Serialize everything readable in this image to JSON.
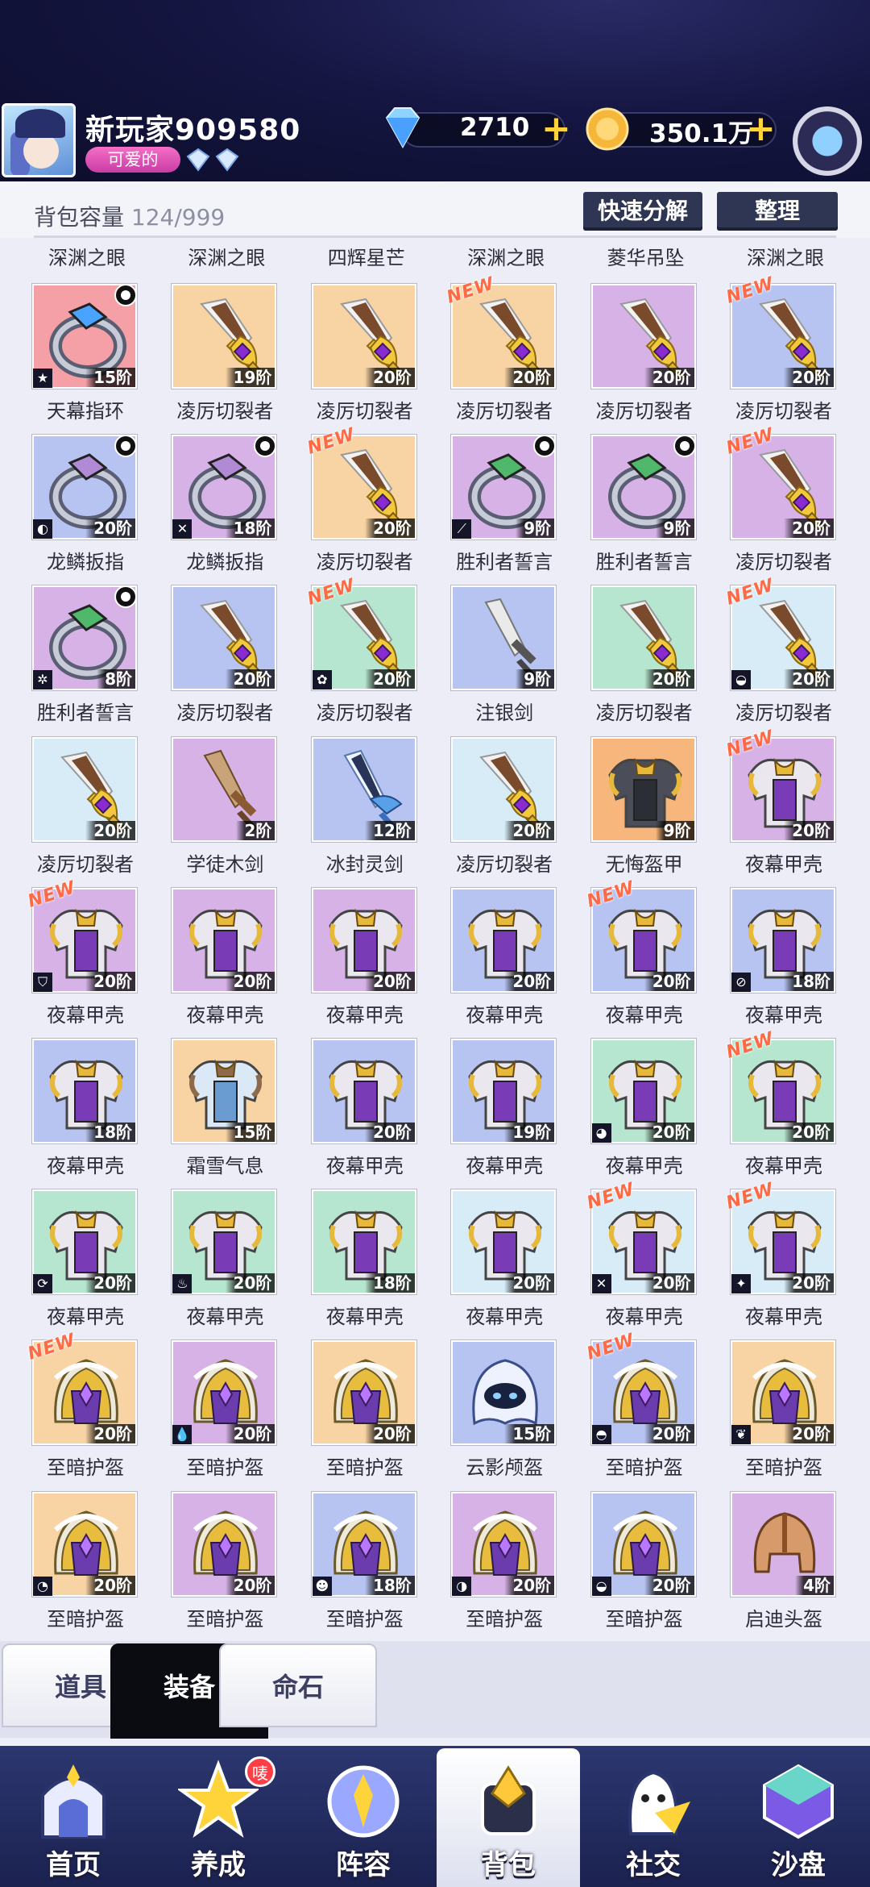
{
  "player": {
    "name": "新玩家909580",
    "tag": "可爱的"
  },
  "resources": {
    "gems": "2710",
    "coins": "350.1万",
    "gem_icon": "diamond-icon",
    "coin_icon": "coin-icon"
  },
  "bag": {
    "capacity_label": "背包容量",
    "capacity_value": "124/999",
    "decompose_label": "快速分解",
    "sort_label": "整理"
  },
  "partial_row_names": [
    "深渊之眼",
    "深渊之眼",
    "四辉星芒",
    "深渊之眼",
    "菱华吊坠",
    "深渊之眼"
  ],
  "items": [
    {
      "name": "天幕指环",
      "level": "15阶",
      "type": "ring",
      "gem": "#4aa3ff",
      "bg": "#f5a0a6",
      "new": false,
      "socket": true,
      "slot": "★"
    },
    {
      "name": "凌厉切裂者",
      "level": "19阶",
      "type": "sword",
      "bg": "#f8d3a4",
      "new": false,
      "socket": false,
      "slot": ""
    },
    {
      "name": "凌厉切裂者",
      "level": "20阶",
      "type": "sword",
      "bg": "#f8d3a4",
      "new": false,
      "socket": false,
      "slot": ""
    },
    {
      "name": "凌厉切裂者",
      "level": "20阶",
      "type": "sword",
      "bg": "#f8d3a4",
      "new": true,
      "socket": false,
      "slot": ""
    },
    {
      "name": "凌厉切裂者",
      "level": "20阶",
      "type": "sword",
      "bg": "#d6b2e6",
      "new": false,
      "socket": false,
      "slot": ""
    },
    {
      "name": "凌厉切裂者",
      "level": "20阶",
      "type": "sword",
      "bg": "#b7c3f1",
      "new": true,
      "socket": false,
      "slot": ""
    },
    {
      "name": "龙鳞扳指",
      "level": "20阶",
      "type": "ring",
      "gem": "#b18ad6",
      "bg": "#b7c3f1",
      "new": false,
      "socket": true,
      "slot": "◐"
    },
    {
      "name": "龙鳞扳指",
      "level": "18阶",
      "type": "ring",
      "gem": "#b18ad6",
      "bg": "#d6b2e6",
      "new": false,
      "socket": true,
      "slot": "✕"
    },
    {
      "name": "凌厉切裂者",
      "level": "20阶",
      "type": "sword",
      "bg": "#f8d3a4",
      "new": true,
      "socket": false,
      "slot": ""
    },
    {
      "name": "胜利者誓言",
      "level": "9阶",
      "type": "ring",
      "gem": "#4fb86a",
      "bg": "#d6b2e6",
      "new": false,
      "socket": true,
      "slot": "⟋"
    },
    {
      "name": "胜利者誓言",
      "level": "9阶",
      "type": "ring",
      "gem": "#4fb86a",
      "bg": "#d6b2e6",
      "new": false,
      "socket": true,
      "slot": ""
    },
    {
      "name": "凌厉切裂者",
      "level": "20阶",
      "type": "sword",
      "bg": "#d6b2e6",
      "new": true,
      "socket": false,
      "slot": ""
    },
    {
      "name": "胜利者誓言",
      "level": "8阶",
      "type": "ring",
      "gem": "#4fb86a",
      "bg": "#d6b2e6",
      "new": false,
      "socket": true,
      "slot": "✲"
    },
    {
      "name": "凌厉切裂者",
      "level": "20阶",
      "type": "sword",
      "bg": "#b7c3f1",
      "new": false,
      "socket": false,
      "slot": ""
    },
    {
      "name": "凌厉切裂者",
      "level": "20阶",
      "type": "sword",
      "bg": "#b6e6cf",
      "new": true,
      "socket": false,
      "slot": "✿"
    },
    {
      "name": "注银剑",
      "level": "9阶",
      "type": "plainsword",
      "bg": "#b7c3f1",
      "new": false,
      "socket": false,
      "slot": ""
    },
    {
      "name": "凌厉切裂者",
      "level": "20阶",
      "type": "sword",
      "bg": "#b6e6cf",
      "new": false,
      "socket": false,
      "slot": ""
    },
    {
      "name": "凌厉切裂者",
      "level": "20阶",
      "type": "sword",
      "bg": "#d7ecf7",
      "new": true,
      "socket": false,
      "slot": "◒"
    },
    {
      "name": "凌厉切裂者",
      "level": "20阶",
      "type": "sword",
      "bg": "#d7ecf7",
      "new": false,
      "socket": false,
      "slot": ""
    },
    {
      "name": "学徒木剑",
      "level": "2阶",
      "type": "woodsword",
      "bg": "#d6b2e6",
      "new": false,
      "socket": false,
      "slot": ""
    },
    {
      "name": "冰封灵剑",
      "level": "12阶",
      "type": "icesword",
      "bg": "#b7c3f1",
      "new": false,
      "socket": false,
      "slot": ""
    },
    {
      "name": "凌厉切裂者",
      "level": "20阶",
      "type": "sword",
      "bg": "#d7ecf7",
      "new": false,
      "socket": false,
      "slot": ""
    },
    {
      "name": "无悔盔甲",
      "level": "9阶",
      "type": "darkarmor",
      "bg": "#f7b77c",
      "new": false,
      "socket": false,
      "slot": ""
    },
    {
      "name": "夜幕甲壳",
      "level": "20阶",
      "type": "armor",
      "bg": "#d6b2e6",
      "new": true,
      "socket": false,
      "slot": ""
    },
    {
      "name": "夜幕甲壳",
      "level": "20阶",
      "type": "armor",
      "bg": "#d6b2e6",
      "new": true,
      "socket": false,
      "slot": "⛉"
    },
    {
      "name": "夜幕甲壳",
      "level": "20阶",
      "type": "armor",
      "bg": "#d6b2e6",
      "new": false,
      "socket": false,
      "slot": ""
    },
    {
      "name": "夜幕甲壳",
      "level": "20阶",
      "type": "armor",
      "bg": "#d6b2e6",
      "new": false,
      "socket": false,
      "slot": ""
    },
    {
      "name": "夜幕甲壳",
      "level": "20阶",
      "type": "armor",
      "bg": "#b7c3f1",
      "new": false,
      "socket": false,
      "slot": ""
    },
    {
      "name": "夜幕甲壳",
      "level": "20阶",
      "type": "armor",
      "bg": "#b7c3f1",
      "new": true,
      "socket": false,
      "slot": ""
    },
    {
      "name": "夜幕甲壳",
      "level": "18阶",
      "type": "armor",
      "bg": "#b7c3f1",
      "new": false,
      "socket": false,
      "slot": "⊘"
    },
    {
      "name": "夜幕甲壳",
      "level": "18阶",
      "type": "armor",
      "bg": "#b7c3f1",
      "new": false,
      "socket": false,
      "slot": ""
    },
    {
      "name": "霜雪气息",
      "level": "15阶",
      "type": "frostarmor",
      "bg": "#f8d3a4",
      "new": false,
      "socket": false,
      "slot": ""
    },
    {
      "name": "夜幕甲壳",
      "level": "20阶",
      "type": "armor",
      "bg": "#b7c3f1",
      "new": false,
      "socket": false,
      "slot": ""
    },
    {
      "name": "夜幕甲壳",
      "level": "19阶",
      "type": "armor",
      "bg": "#b7c3f1",
      "new": false,
      "socket": false,
      "slot": ""
    },
    {
      "name": "夜幕甲壳",
      "level": "20阶",
      "type": "armor",
      "bg": "#b6e6cf",
      "new": false,
      "socket": false,
      "slot": "◕"
    },
    {
      "name": "夜幕甲壳",
      "level": "20阶",
      "type": "armor",
      "bg": "#b6e6cf",
      "new": true,
      "socket": false,
      "slot": ""
    },
    {
      "name": "夜幕甲壳",
      "level": "20阶",
      "type": "armor",
      "bg": "#b6e6cf",
      "new": false,
      "socket": false,
      "slot": "⟳"
    },
    {
      "name": "夜幕甲壳",
      "level": "20阶",
      "type": "armor",
      "bg": "#b6e6cf",
      "new": false,
      "socket": false,
      "slot": "♨"
    },
    {
      "name": "夜幕甲壳",
      "level": "18阶",
      "type": "armor",
      "bg": "#b6e6cf",
      "new": false,
      "socket": false,
      "slot": ""
    },
    {
      "name": "夜幕甲壳",
      "level": "20阶",
      "type": "armor",
      "bg": "#d7ecf7",
      "new": false,
      "socket": false,
      "slot": ""
    },
    {
      "name": "夜幕甲壳",
      "level": "20阶",
      "type": "armor",
      "bg": "#d7ecf7",
      "new": true,
      "socket": false,
      "slot": "✕"
    },
    {
      "name": "夜幕甲壳",
      "level": "20阶",
      "type": "armor",
      "bg": "#d7ecf7",
      "new": true,
      "socket": false,
      "slot": "✦"
    },
    {
      "name": "至暗护盔",
      "level": "20阶",
      "type": "helm",
      "bg": "#f8d3a4",
      "new": true,
      "socket": false,
      "slot": ""
    },
    {
      "name": "至暗护盔",
      "level": "20阶",
      "type": "helm",
      "bg": "#d6b2e6",
      "new": false,
      "socket": false,
      "slot": "💧"
    },
    {
      "name": "至暗护盔",
      "level": "20阶",
      "type": "helm",
      "bg": "#f8d3a4",
      "new": false,
      "socket": false,
      "slot": ""
    },
    {
      "name": "云影颅盔",
      "level": "15阶",
      "type": "ghosthelm",
      "bg": "#b7c3f1",
      "new": false,
      "socket": false,
      "slot": ""
    },
    {
      "name": "至暗护盔",
      "level": "20阶",
      "type": "helm",
      "bg": "#b7c3f1",
      "new": true,
      "socket": false,
      "slot": "◓"
    },
    {
      "name": "至暗护盔",
      "level": "20阶",
      "type": "helm",
      "bg": "#f8d3a4",
      "new": false,
      "socket": false,
      "slot": "❦"
    },
    {
      "name": "至暗护盔",
      "level": "20阶",
      "type": "helm",
      "bg": "#f8d3a4",
      "new": false,
      "socket": false,
      "slot": "◔"
    },
    {
      "name": "至暗护盔",
      "level": "20阶",
      "type": "helm",
      "bg": "#d6b2e6",
      "new": false,
      "socket": false,
      "slot": ""
    },
    {
      "name": "至暗护盔",
      "level": "18阶",
      "type": "helm",
      "bg": "#b7c3f1",
      "new": false,
      "socket": false,
      "slot": "☻"
    },
    {
      "name": "至暗护盔",
      "level": "20阶",
      "type": "helm",
      "bg": "#d6b2e6",
      "new": false,
      "socket": false,
      "slot": "◑"
    },
    {
      "name": "至暗护盔",
      "level": "20阶",
      "type": "helm",
      "bg": "#b7c3f1",
      "new": false,
      "socket": false,
      "slot": "◒"
    },
    {
      "name": "启迪头盔",
      "level": "4阶",
      "type": "leatherhelm",
      "bg": "#d6b2e6",
      "new": false,
      "socket": false,
      "slot": ""
    }
  ],
  "new_label": "NEW",
  "category_tabs": [
    {
      "label": "道具",
      "active": false
    },
    {
      "label": "装备",
      "active": true
    },
    {
      "label": "命石",
      "active": false
    }
  ],
  "nav": [
    {
      "label": "首页",
      "icon": "home-gate-icon",
      "active": false,
      "badge": ""
    },
    {
      "label": "养成",
      "icon": "star-upgrade-icon",
      "active": false,
      "badge": "唛"
    },
    {
      "label": "阵容",
      "icon": "formation-shield-icon",
      "active": false,
      "badge": ""
    },
    {
      "label": "背包",
      "icon": "backpack-icon",
      "active": true,
      "badge": ""
    },
    {
      "label": "社交",
      "icon": "ghost-mail-icon",
      "active": false,
      "badge": ""
    },
    {
      "label": "沙盘",
      "icon": "sandbox-cube-icon",
      "active": false,
      "badge": ""
    }
  ]
}
